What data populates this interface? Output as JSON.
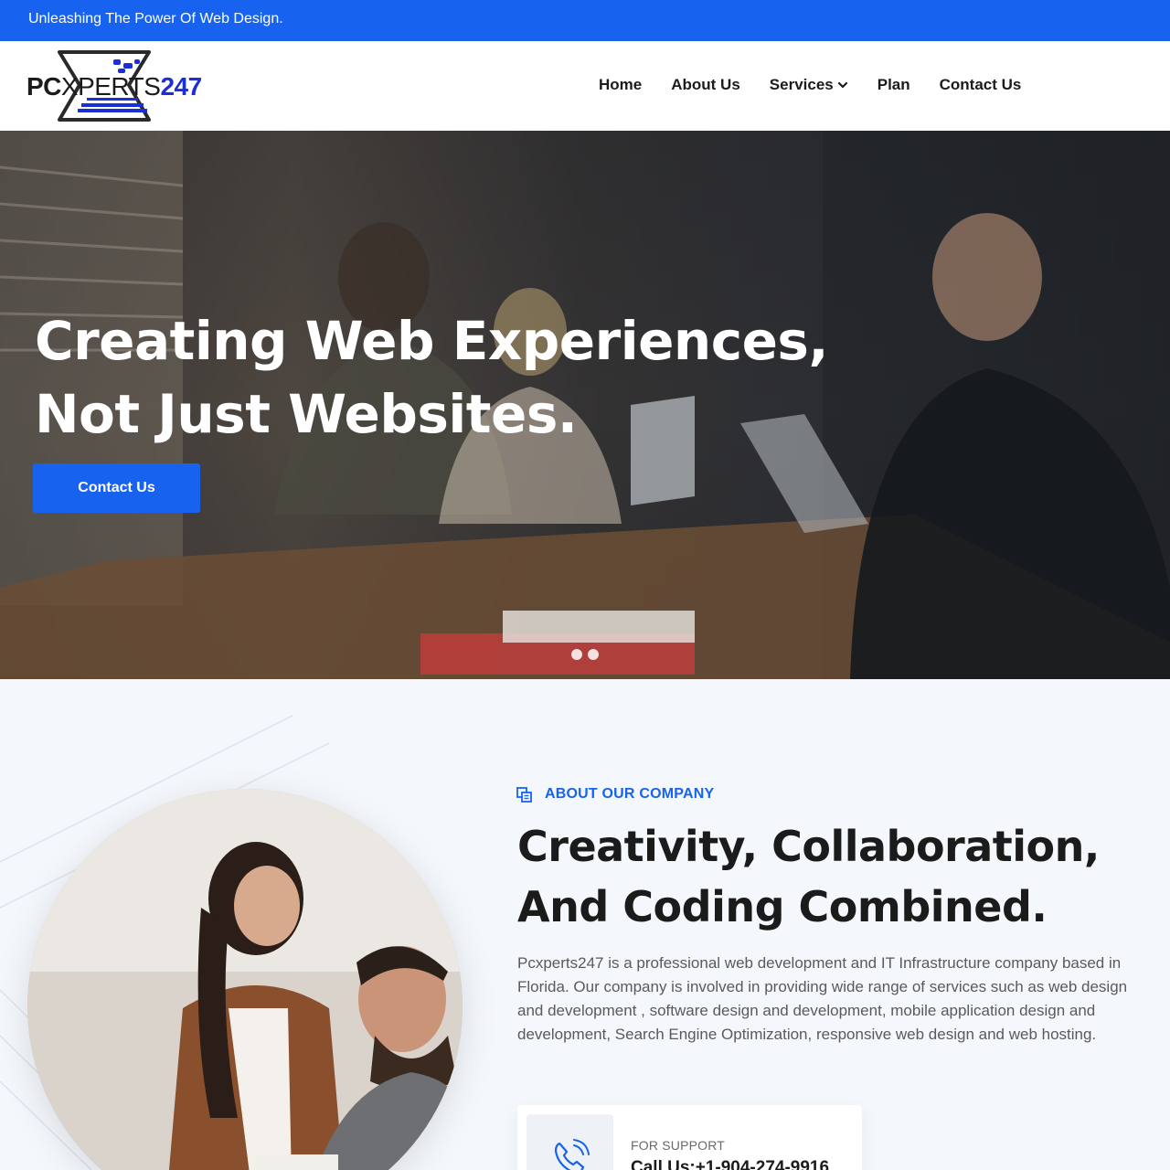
{
  "topbar": {
    "tagline": "Unleashing The Power Of Web Design."
  },
  "logo": {
    "pc": "PC",
    "xperts": "XPERTS",
    "num": "247"
  },
  "nav": {
    "items": [
      {
        "label": "Home"
      },
      {
        "label": "About Us"
      },
      {
        "label": "Services",
        "has_dropdown": true
      },
      {
        "label": "Plan"
      },
      {
        "label": "Contact Us"
      }
    ]
  },
  "hero": {
    "title_line1": "Creating Web Experiences,",
    "title_line2": "Not Just Websites.",
    "cta_label": "Contact Us",
    "slides": 2
  },
  "about": {
    "kicker": "ABOUT OUR COMPANY",
    "title_line1": "Creativity, Collaboration,",
    "title_line2": "And Coding Combined.",
    "description": "Pcxperts247 is a professional web development and IT Infrastructure company based in Florida. Our company is involved in providing wide range of services such as web design and development , software design and development, mobile application design and development, Search Engine Optimization, responsive web design and web hosting.",
    "support": {
      "label": "FOR SUPPORT",
      "phone": "Call Us:+1-904-274-9916"
    }
  },
  "colors": {
    "accent": "#1763ef",
    "logo_blue": "#1a2fd6",
    "text_dark": "#1b1b1b",
    "section_bg": "#f4f7fb"
  },
  "icons": [
    "chevron-down-icon",
    "copy-icon",
    "phone-icon"
  ]
}
